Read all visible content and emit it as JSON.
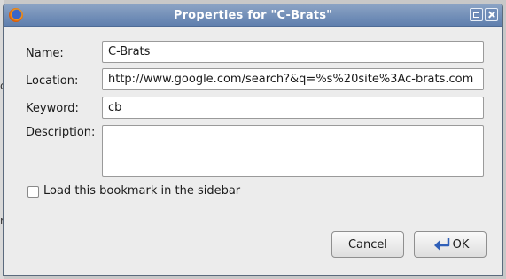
{
  "window": {
    "title": "Properties for \"C-Brats\""
  },
  "form": {
    "name_label": "Name:",
    "name_value": "C-Brats",
    "location_label": "Location:",
    "location_value": "http://www.google.com/search?&q=%s%20site%3Ac-brats.com",
    "keyword_label": "Keyword:",
    "keyword_value": "cb",
    "description_label": "Description:",
    "description_value": "",
    "sidebar_checkbox_label": "Load this bookmark in the sidebar",
    "sidebar_checked": false
  },
  "buttons": {
    "cancel": "Cancel",
    "ok": "OK"
  },
  "background": {
    "fragment_1": "c",
    "fragment_2": "r"
  },
  "icons": {
    "app": "firefox-icon",
    "maximize": "maximize-icon",
    "close": "close-icon",
    "ok": "enter-arrow-icon"
  },
  "colors": {
    "titlebar": "#6f8cb8",
    "dialog_bg": "#ececec",
    "accent_icon": "#3a6ec9"
  }
}
